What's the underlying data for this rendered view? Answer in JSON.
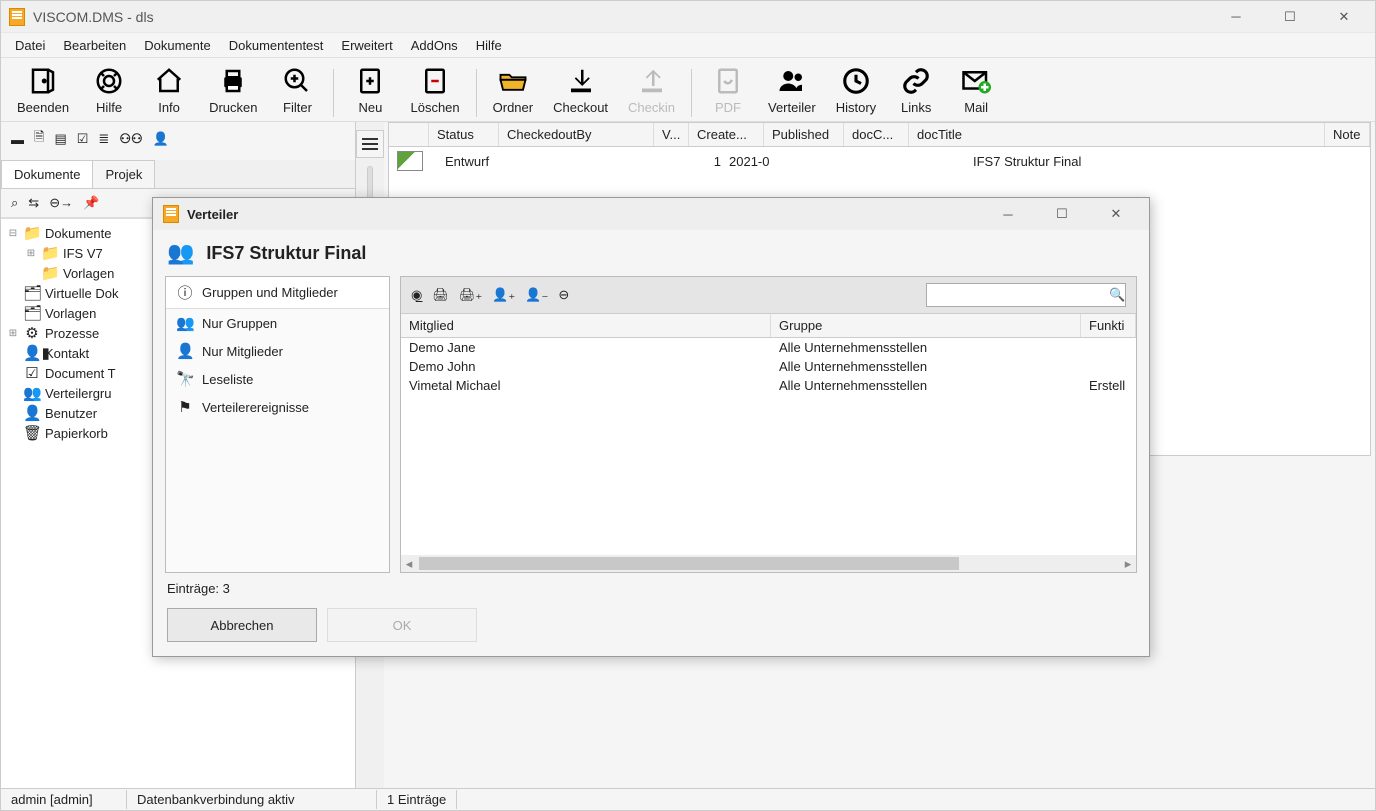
{
  "window": {
    "title": "VISCOM.DMS - dls"
  },
  "menu": [
    "Datei",
    "Bearbeiten",
    "Dokumente",
    "Dokumententest",
    "Erweitert",
    "AddOns",
    "Hilfe"
  ],
  "toolbar": [
    {
      "name": "beenden",
      "label": "Beenden",
      "icon": "door"
    },
    {
      "name": "hilfe",
      "label": "Hilfe",
      "icon": "life-ring"
    },
    {
      "name": "info",
      "label": "Info",
      "icon": "home"
    },
    {
      "name": "drucken",
      "label": "Drucken",
      "icon": "printer"
    },
    {
      "name": "filter",
      "label": "Filter",
      "icon": "zoom-plus"
    },
    {
      "sep": true
    },
    {
      "name": "neu",
      "label": "Neu",
      "icon": "doc-plus"
    },
    {
      "name": "loeschen",
      "label": "Löschen",
      "icon": "doc-minus"
    },
    {
      "sep": true
    },
    {
      "name": "ordner",
      "label": "Ordner",
      "icon": "folder-open"
    },
    {
      "name": "checkout",
      "label": "Checkout",
      "icon": "download"
    },
    {
      "name": "checkin",
      "label": "Checkin",
      "icon": "upload",
      "disabled": true,
      "drop": true
    },
    {
      "sep": true
    },
    {
      "name": "pdf",
      "label": "PDF",
      "icon": "pdf",
      "disabled": true
    },
    {
      "name": "verteiler",
      "label": "Verteiler",
      "icon": "people"
    },
    {
      "name": "history",
      "label": "History",
      "icon": "clock"
    },
    {
      "name": "links",
      "label": "Links",
      "icon": "link"
    },
    {
      "name": "mail",
      "label": "Mail",
      "icon": "mail-plus",
      "drop": true
    }
  ],
  "tabs": {
    "active": "Dokumente",
    "other": "Projek"
  },
  "tree": [
    {
      "indent": 0,
      "exp": "-",
      "icon": "folder",
      "label": "Dokumente"
    },
    {
      "indent": 1,
      "exp": "+",
      "icon": "folder",
      "label": "IFS V7"
    },
    {
      "indent": 1,
      "exp": "",
      "icon": "folder",
      "label": "Vorlagen"
    },
    {
      "indent": 0,
      "exp": "",
      "icon": "vfolder",
      "label": "Virtuelle Dok"
    },
    {
      "indent": 0,
      "exp": "",
      "icon": "vfolder",
      "label": "Vorlagen"
    },
    {
      "indent": 0,
      "exp": "+",
      "icon": "process",
      "label": "Prozesse"
    },
    {
      "indent": 0,
      "exp": "",
      "icon": "contact",
      "label": "Kontakt"
    },
    {
      "indent": 0,
      "exp": "",
      "icon": "doctype",
      "label": "Document T"
    },
    {
      "indent": 0,
      "exp": "",
      "icon": "vgroup",
      "label": "Verteilergru"
    },
    {
      "indent": 0,
      "exp": "",
      "icon": "user",
      "label": "Benutzer"
    },
    {
      "indent": 0,
      "exp": "",
      "icon": "trash",
      "label": "Papierkorb"
    }
  ],
  "grid": {
    "headers": [
      "Status",
      "CheckedoutBy",
      "V...",
      "Create...",
      "Published",
      "docC...",
      "docTitle",
      "Note"
    ],
    "row": {
      "status": "Entwurf",
      "v": "1",
      "create": "2021-0",
      "docTitle": "IFS7 Struktur Final"
    }
  },
  "status": {
    "user": "admin [admin]",
    "db": "Datenbankverbindung aktiv",
    "entries": "1 Einträge"
  },
  "dialog": {
    "title": "Verteiler",
    "header": "IFS7 Struktur Final",
    "sidebar": [
      {
        "icon": "info",
        "label": "Gruppen und Mitglieder",
        "sel": true
      },
      {
        "icon": "people",
        "label": "Nur Gruppen"
      },
      {
        "icon": "user",
        "label": "Nur Mitglieder"
      },
      {
        "icon": "binoc",
        "label": "Leseliste"
      },
      {
        "icon": "flag",
        "label": "Verteilerereignisse"
      }
    ],
    "tableHeaders": {
      "m": "Mitglied",
      "g": "Gruppe",
      "f": "Funkti"
    },
    "rows": [
      {
        "m": "Demo Jane",
        "g": "Alle Unternehmensstellen",
        "f": ""
      },
      {
        "m": "Demo John",
        "g": "Alle Unternehmensstellen",
        "f": ""
      },
      {
        "m": "Vimetal Michael",
        "g": "Alle Unternehmensstellen",
        "f": "Erstell"
      }
    ],
    "footer": "Einträge: 3",
    "buttons": {
      "cancel": "Abbrechen",
      "ok": "OK"
    }
  }
}
